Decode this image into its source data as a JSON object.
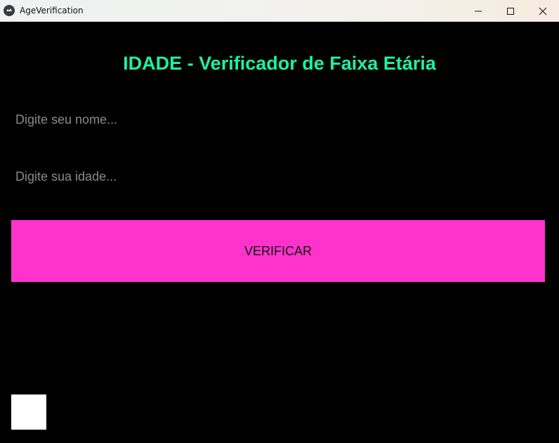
{
  "window": {
    "title": "AgeVerification",
    "icon": "kivy-app-icon",
    "controls": [
      "minimize-icon",
      "maximize-icon",
      "close-icon"
    ]
  },
  "main": {
    "heading": "IDADE - Verificador de Faixa Etária",
    "name_input": {
      "value": "",
      "placeholder": "Digite seu nome..."
    },
    "age_input": {
      "value": "",
      "placeholder": "Digite sua idade..."
    },
    "verify_button": "VERIFICAR"
  },
  "colors": {
    "background": "#000000",
    "heading": "#1ff0a0",
    "button": "#ff33cc",
    "placeholder": "#8a8a8a"
  }
}
